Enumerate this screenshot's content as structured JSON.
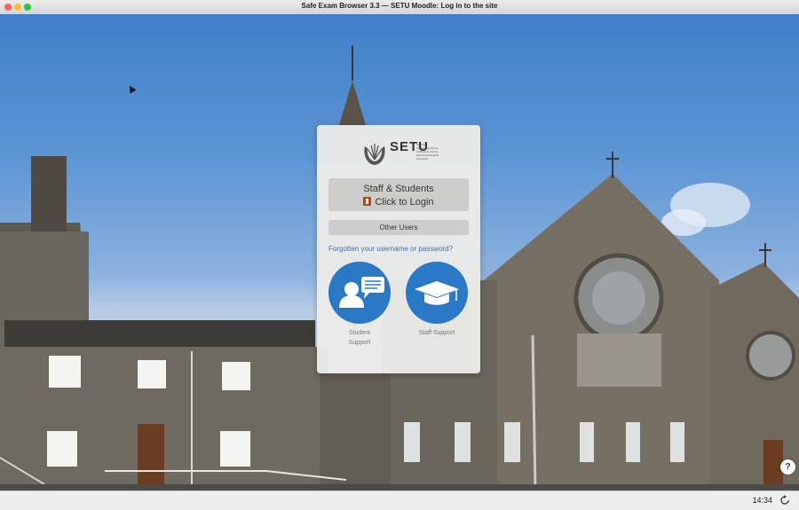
{
  "window": {
    "title": "Safe Exam Browser 3.3  —  SETU Moodle: Log in to the site"
  },
  "login": {
    "logo_text": "SETU",
    "logo_subtitle": "Ollscoil Teicneolaíochta an Oirdheiscirt South East Technological University",
    "primary_line1": "Staff & Students",
    "primary_line2": "Click to Login",
    "primary_icon": "office-icon",
    "secondary_label": "Other Users",
    "forgot_link": "Forgotten your username or password?",
    "student_support_label": "Student Support",
    "staff_support_label": "Staff Support"
  },
  "taskbar": {
    "clock": "14:34",
    "reload_icon": "reload-icon"
  },
  "help": {
    "label": "?"
  },
  "colors": {
    "accent": "#2a79c7",
    "link": "#3d6fb0",
    "card": "#ebebe9",
    "button": "#cdcdcb"
  }
}
